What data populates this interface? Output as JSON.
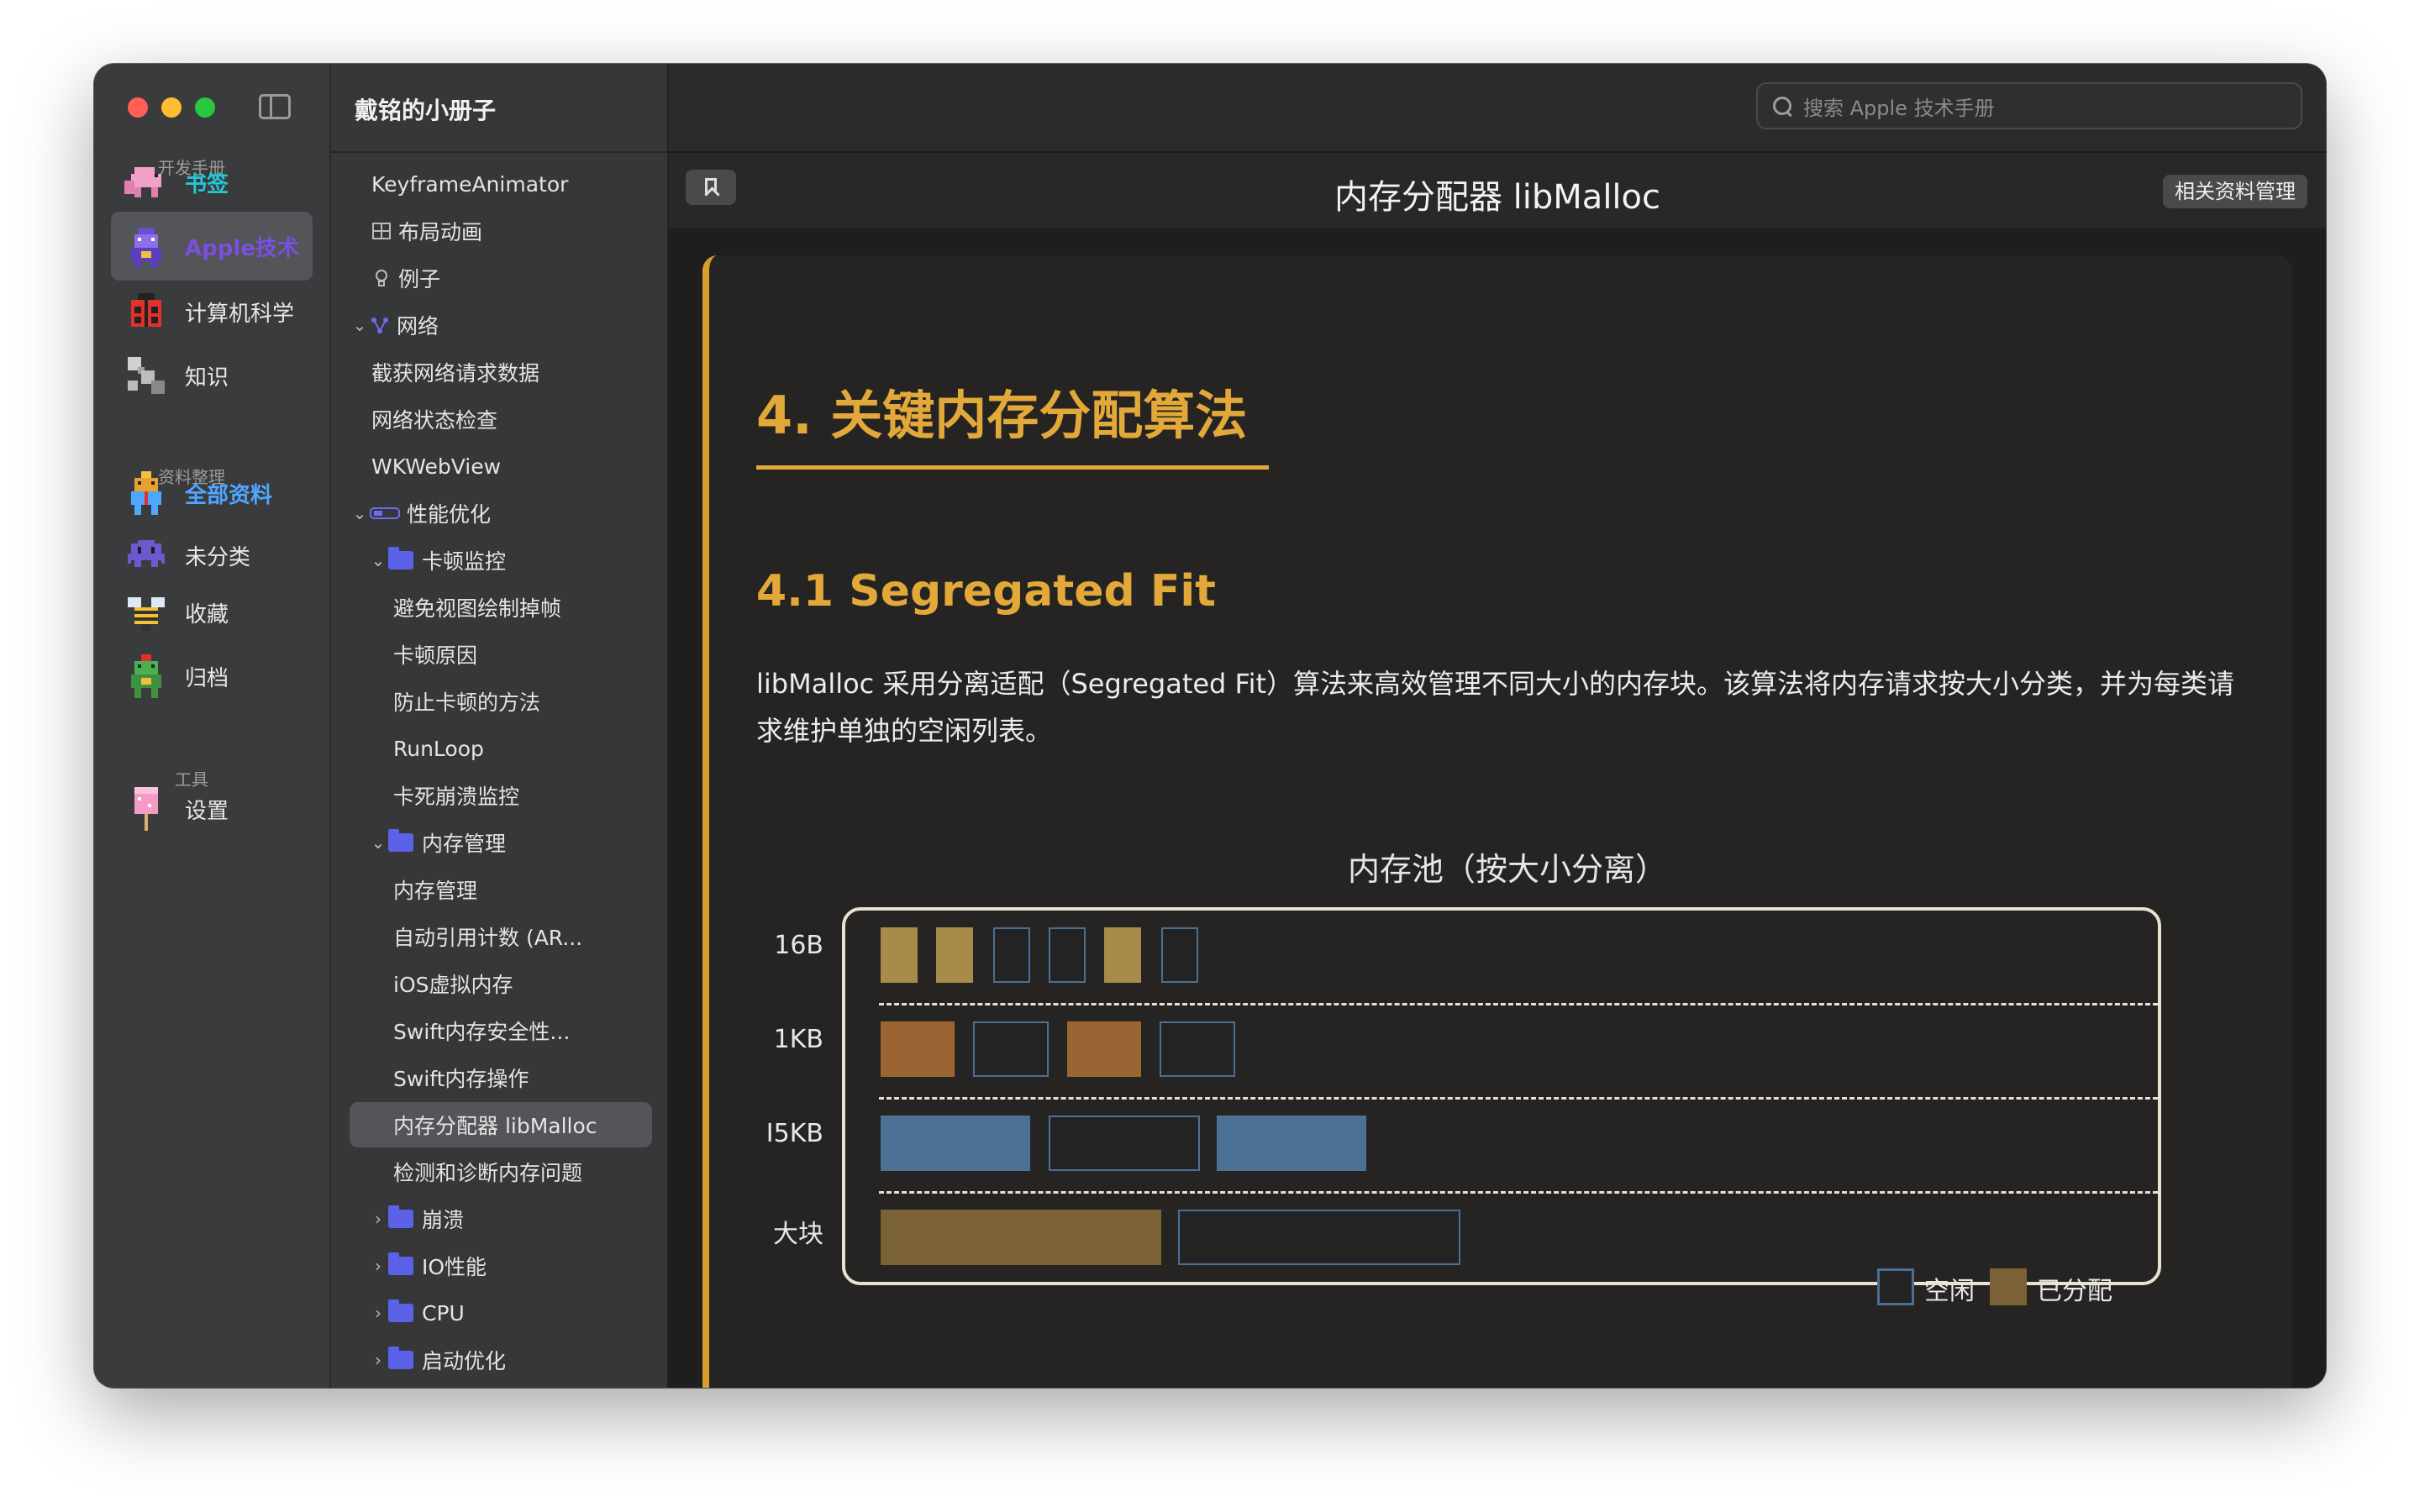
{
  "window": {
    "traffic_lights": [
      "close",
      "minimize",
      "zoom"
    ]
  },
  "sidebar": {
    "sections": [
      {
        "label": "开发手册"
      },
      {
        "label": "资料整理"
      },
      {
        "label": "工具"
      }
    ],
    "items": [
      {
        "label": "书签",
        "icon": "pink-elephant-icon"
      },
      {
        "label": "Apple技术",
        "icon": "purple-robot-icon"
      },
      {
        "label": "计算机科学",
        "icon": "ladybug-icon"
      },
      {
        "label": "知识",
        "icon": "pixel-tool-icon"
      },
      {
        "label": "全部资料",
        "icon": "gift-robot-icon"
      },
      {
        "label": "未分类",
        "icon": "space-invader-icon"
      },
      {
        "label": "收藏",
        "icon": "bee-icon"
      },
      {
        "label": "归档",
        "icon": "frog-icon"
      },
      {
        "label": "设置",
        "icon": "popsicle-icon"
      }
    ]
  },
  "tree": {
    "app_title": "戴铭的小册子",
    "rows": [
      {
        "label": "KeyframeAnimator"
      },
      {
        "label": "布局动画"
      },
      {
        "label": "例子"
      },
      {
        "label": "网络"
      },
      {
        "label": "截获网络请求数据"
      },
      {
        "label": "网络状态检查"
      },
      {
        "label": "WKWebView"
      },
      {
        "label": "性能优化"
      },
      {
        "label": "卡顿监控"
      },
      {
        "label": "避免视图绘制掉帧"
      },
      {
        "label": "卡顿原因"
      },
      {
        "label": "防止卡顿的方法"
      },
      {
        "label": "RunLoop"
      },
      {
        "label": "卡死崩溃监控"
      },
      {
        "label": "内存管理"
      },
      {
        "label": "内存管理"
      },
      {
        "label": "自动引用计数 (AR..."
      },
      {
        "label": "iOS虚拟内存"
      },
      {
        "label": "Swift内存安全性..."
      },
      {
        "label": "Swift内存操作"
      },
      {
        "label": "内存分配器 libMalloc"
      },
      {
        "label": "检测和诊断内存问题"
      },
      {
        "label": "崩溃"
      },
      {
        "label": "IO性能"
      },
      {
        "label": "CPU"
      },
      {
        "label": "启动优化"
      }
    ]
  },
  "topbar": {
    "search_placeholder": "搜索 Apple 技术手册"
  },
  "docbar": {
    "title": "内存分配器 libMalloc",
    "related_button": "相关资料管理"
  },
  "article": {
    "h1": "4. 关键内存分配算法",
    "h2": "4.1 Segregated Fit",
    "paragraph": "libMalloc 采用分离适配（Segregated Fit）算法来高效管理不同大小的内存块。该算法将内存请求按大小分类，并为每类请求维护单独的空闲列表。"
  },
  "diagram": {
    "title": "内存池（按大小分离）",
    "rows": [
      {
        "label": "16B"
      },
      {
        "label": "1KB"
      },
      {
        "label": "I5KB"
      },
      {
        "label": "大块"
      }
    ],
    "legend": {
      "free": "空闲",
      "used": "已分配"
    },
    "colors": {
      "used_16b": "#a88b4a",
      "used_1kb": "#9a6532",
      "used_15kb": "#4b7294",
      "used_large": "#7a6236",
      "free_border": "#4b6f93",
      "accent": "#e2a93a"
    }
  }
}
